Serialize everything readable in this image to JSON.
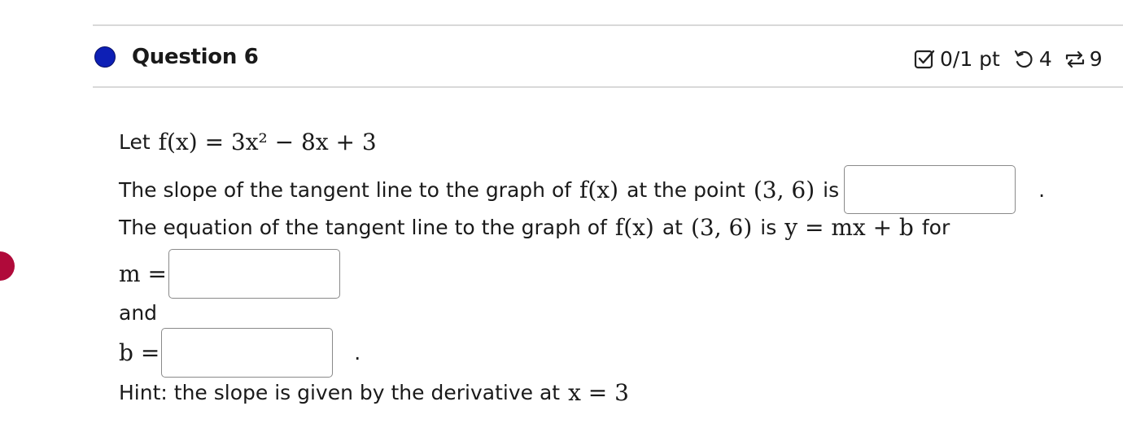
{
  "question": {
    "title": "Question 6",
    "status_color": "#0d1fb5",
    "score": "0/1 pt",
    "attempts": "4",
    "versions": "9"
  },
  "problem": {
    "let_label": "Let",
    "function": "f(x) = 3x² − 8x + 3",
    "slope_prefix": "The slope of the tangent line to the graph of",
    "slope_func": "f(x)",
    "slope_mid": "at the point",
    "point": "(3, 6)",
    "slope_suffix": "is",
    "slope_end": ".",
    "eq_prefix": "The equation of the tangent line to the graph of",
    "eq_func": "f(x)",
    "eq_at": "at",
    "eq_point": "(3, 6)",
    "eq_is": "is",
    "eq_form": "y = mx + b",
    "eq_for": "for",
    "m_label": "m =",
    "and_label": "and",
    "b_label": "b =",
    "b_end": ".",
    "hint_text": "Hint: the slope is given by the derivative at",
    "hint_math": "x = 3"
  },
  "icons": {
    "score": "checkbox-icon",
    "attempts": "retry-icon",
    "versions": "versions-icon"
  }
}
